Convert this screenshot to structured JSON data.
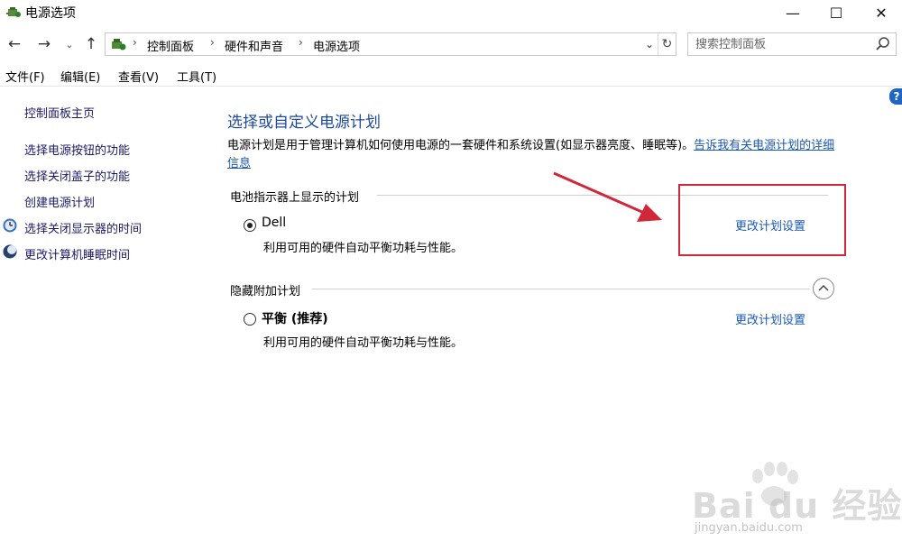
{
  "window": {
    "title": "电源选项",
    "minimize_glyph": "—",
    "maximize_glyph": "☐",
    "close_glyph": "✕"
  },
  "nav": {
    "back_glyph": "←",
    "forward_glyph": "→",
    "recent_glyph": "⌄",
    "up_glyph": "↑"
  },
  "breadcrumb": {
    "items": [
      "控制面板",
      "硬件和声音",
      "电源选项"
    ],
    "separator": "›"
  },
  "search": {
    "placeholder": "搜索控制面板"
  },
  "menu": {
    "items": [
      "文件(F)",
      "编辑(E)",
      "查看(V)",
      "工具(T)"
    ]
  },
  "help": {
    "glyph": "?"
  },
  "sidebar": {
    "items": [
      {
        "label": "控制面板主页",
        "icon": "none"
      },
      {
        "label": "选择电源按钮的功能",
        "icon": "none"
      },
      {
        "label": "选择关闭盖子的功能",
        "icon": "none"
      },
      {
        "label": "创建电源计划",
        "icon": "none"
      },
      {
        "label": "选择关闭显示器的时间",
        "icon": "monitor-icon"
      },
      {
        "label": "更改计算机睡眠时间",
        "icon": "moon-icon"
      }
    ]
  },
  "main": {
    "title": "选择或自定义电源计划",
    "description": "电源计划是用于管理计算机如何使用电源的一套硬件和系统设置(如显示器亮度、睡眠等)。",
    "description_link": "告诉我有关电源计划的详细信息",
    "battery_group": {
      "label": "电池指示器上显示的计划",
      "plan": {
        "name": "Dell",
        "description": "利用可用的硬件自动平衡功耗与性能。",
        "link": "更改计划设置",
        "selected": true
      }
    },
    "hidden_group": {
      "label": "隐藏附加计划",
      "plan": {
        "name": "平衡 (推荐)",
        "description": "利用可用的硬件自动平衡功耗与性能。",
        "link": "更改计划设置",
        "selected": false
      }
    }
  },
  "watermark": {
    "text": "Bai du 经验",
    "url": "jingyan.baidu.com"
  },
  "colors": {
    "link": "#1a59b8",
    "title": "#1e4a9a",
    "annotation_red": "#d0283a"
  }
}
